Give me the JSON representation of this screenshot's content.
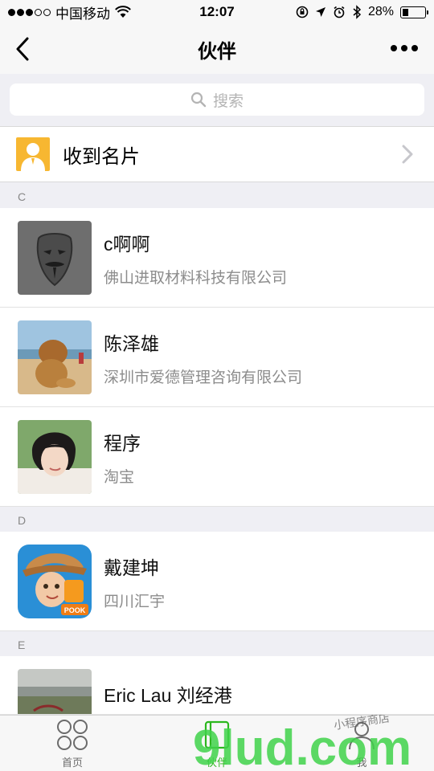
{
  "status_bar": {
    "carrier": "中国移动",
    "time": "12:07",
    "battery_percent": "28%",
    "battery_level": 0.28
  },
  "nav": {
    "title": "伙伴"
  },
  "search": {
    "placeholder": "搜索"
  },
  "received_cards": {
    "label": "收到名片"
  },
  "sections": [
    {
      "letter": "C"
    },
    {
      "letter": "D"
    },
    {
      "letter": "E"
    }
  ],
  "contacts": [
    {
      "name": "c啊啊",
      "company": "佛山进取材料科技有限公司",
      "avatar": "mask-avatar"
    },
    {
      "name": "陈泽雄",
      "company": "深圳市爱德管理咨询有限公司",
      "avatar": "lion-beach-avatar"
    },
    {
      "name": "程序",
      "company": "淘宝",
      "avatar": "girl-portrait-avatar"
    },
    {
      "name": "戴建坤",
      "company": "四川汇宇",
      "avatar": "cartoon-pook-avatar"
    },
    {
      "name": "Eric Lau 刘经港",
      "company": "",
      "avatar": "landscape-avatar"
    }
  ],
  "tab_bar": {
    "tabs": [
      {
        "label": "首页",
        "icon": "home-grid-icon"
      },
      {
        "label": "伙伴",
        "icon": "partner-icon",
        "active": true
      },
      {
        "label": "我",
        "icon": "profile-icon"
      }
    ]
  },
  "watermark": {
    "text": "9lud.com",
    "subtext": "小程序商店"
  },
  "colors": {
    "accent": "#2cb71e",
    "card_icon": "#f7b731",
    "background": "#efeff4"
  }
}
